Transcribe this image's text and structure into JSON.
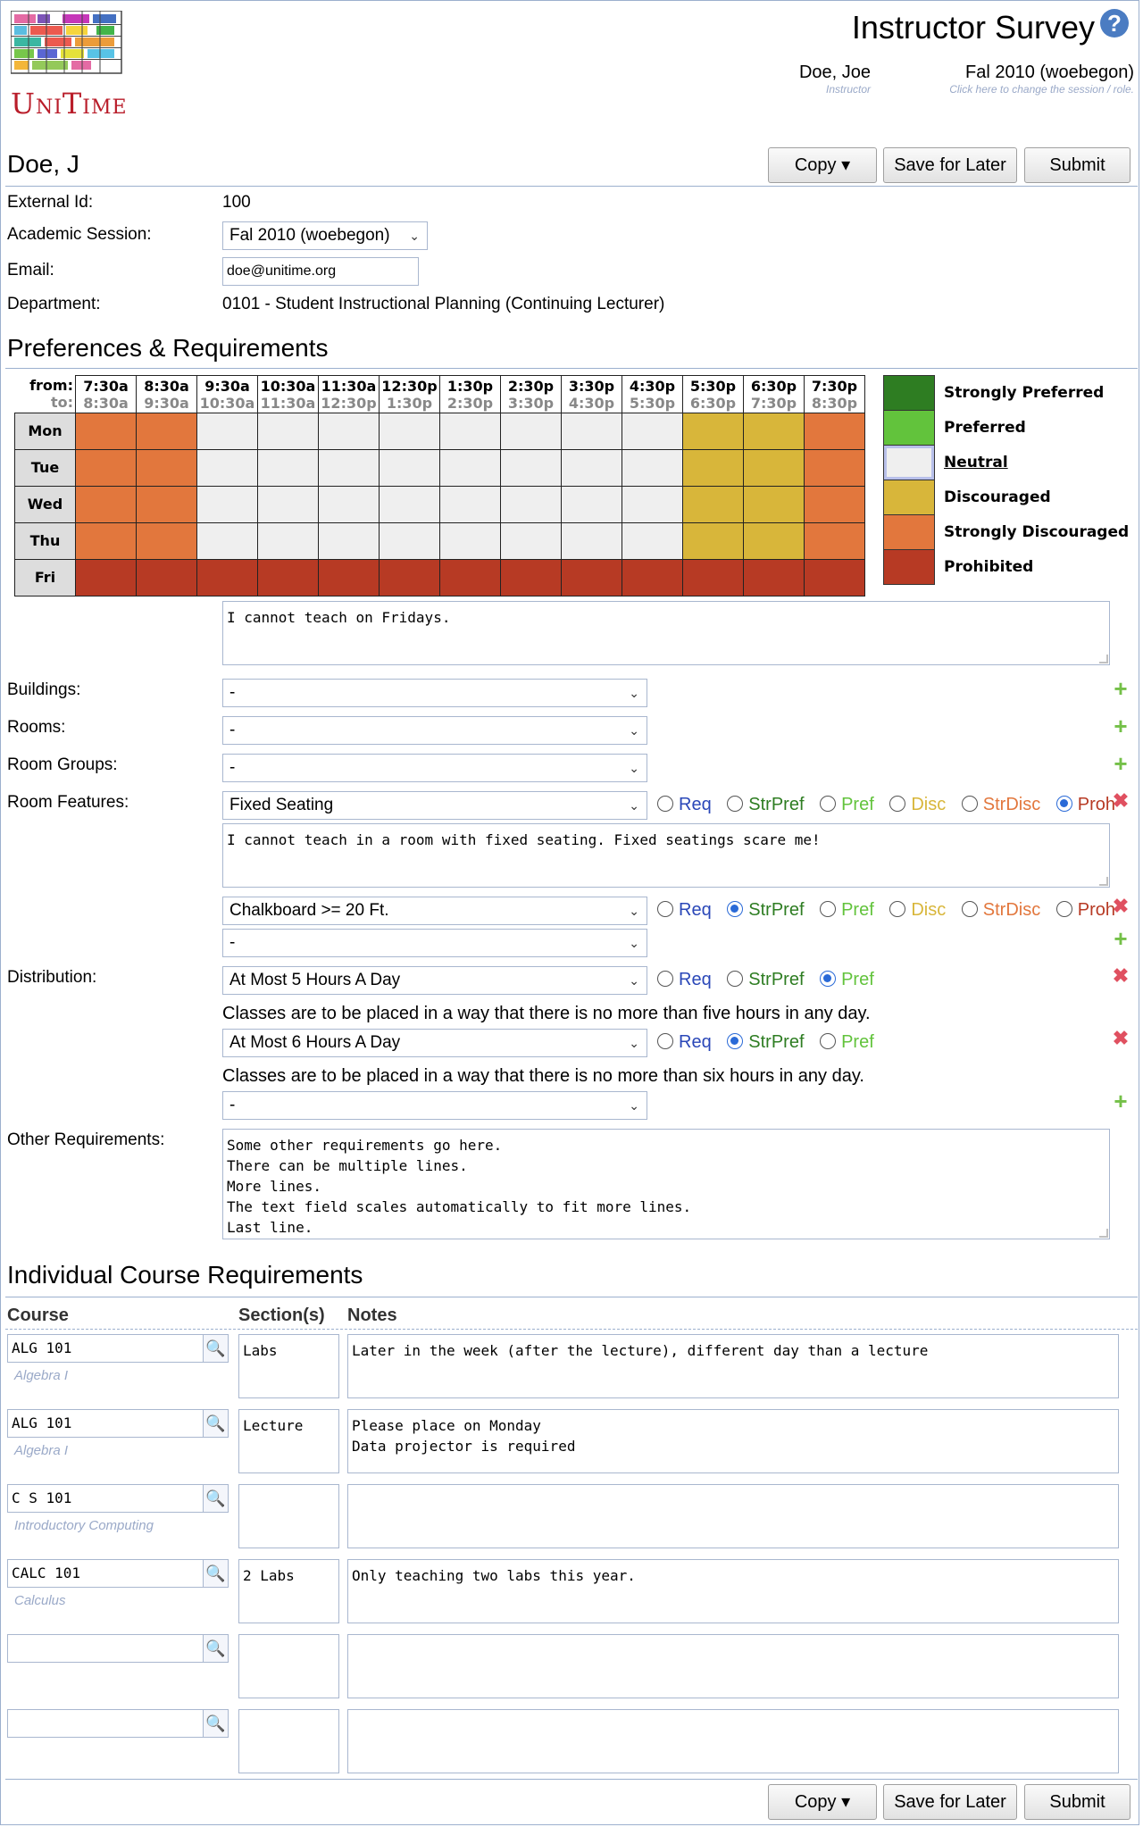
{
  "app": {
    "logo_text": "UniTime",
    "title": "Instructor Survey",
    "help": "?"
  },
  "header": {
    "user_name": "Doe, Joe",
    "user_role": "Instructor",
    "session": "Fal 2010 (woebegon)",
    "session_hint": "Click here to change the session / role."
  },
  "toolbar": {
    "title": "Doe, J",
    "copy": "Copy ▾",
    "save": "Save for Later",
    "submit": "Submit"
  },
  "info": {
    "external_id_label": "External Id:",
    "external_id": "100",
    "session_label": "Academic Session:",
    "session": "Fal 2010 (woebegon)",
    "email_label": "Email:",
    "email": "doe@unitime.org",
    "department_label": "Department:",
    "department": "0101 - Student Instructional Planning (Continuing Lecturer)"
  },
  "prefs": {
    "section_title": "Preferences & Requirements",
    "grid": {
      "from_label": "from:",
      "to_label": "to:",
      "columns": [
        {
          "from": "7:30a",
          "to": "8:30a"
        },
        {
          "from": "8:30a",
          "to": "9:30a"
        },
        {
          "from": "9:30a",
          "to": "10:30a"
        },
        {
          "from": "10:30a",
          "to": "11:30a"
        },
        {
          "from": "11:30a",
          "to": "12:30p"
        },
        {
          "from": "12:30p",
          "to": "1:30p"
        },
        {
          "from": "1:30p",
          "to": "2:30p"
        },
        {
          "from": "2:30p",
          "to": "3:30p"
        },
        {
          "from": "3:30p",
          "to": "4:30p"
        },
        {
          "from": "4:30p",
          "to": "5:30p"
        },
        {
          "from": "5:30p",
          "to": "6:30p"
        },
        {
          "from": "6:30p",
          "to": "7:30p"
        },
        {
          "from": "7:30p",
          "to": "8:30p"
        }
      ],
      "days": [
        "Mon",
        "Tue",
        "Wed",
        "Thu",
        "Fri"
      ],
      "cells": [
        [
          "SD",
          "SD",
          "N",
          "N",
          "N",
          "N",
          "N",
          "N",
          "N",
          "N",
          "D",
          "D",
          "SD"
        ],
        [
          "SD",
          "SD",
          "N",
          "N",
          "N",
          "N",
          "N",
          "N",
          "N",
          "N",
          "D",
          "D",
          "SD"
        ],
        [
          "SD",
          "SD",
          "N",
          "N",
          "N",
          "N",
          "N",
          "N",
          "N",
          "N",
          "D",
          "D",
          "SD"
        ],
        [
          "SD",
          "SD",
          "N",
          "N",
          "N",
          "N",
          "N",
          "N",
          "N",
          "N",
          "D",
          "D",
          "SD"
        ],
        [
          "P",
          "P",
          "P",
          "P",
          "P",
          "P",
          "P",
          "P",
          "P",
          "P",
          "P",
          "P",
          "P"
        ]
      ]
    },
    "legend": [
      {
        "code": "SP",
        "label": "Strongly Preferred",
        "color": "#2e7d22"
      },
      {
        "code": "PR",
        "label": "Preferred",
        "color": "#62c33c"
      },
      {
        "code": "N",
        "label": "Neutral",
        "color": "#efefef"
      },
      {
        "code": "D",
        "label": "Discouraged",
        "color": "#d8b63a"
      },
      {
        "code": "SD",
        "label": "Strongly Discouraged",
        "color": "#e2773d"
      },
      {
        "code": "P",
        "label": "Prohibited",
        "color": "#b73a24"
      }
    ],
    "time_note": "I cannot teach on Fridays.",
    "buildings_label": "Buildings:",
    "buildings": "-",
    "rooms_label": "Rooms:",
    "rooms": "-",
    "room_groups_label": "Room Groups:",
    "room_groups": "-",
    "room_features_label": "Room Features:",
    "feature1": "Fixed Seating",
    "feature1_note": "I cannot teach in a room with fixed seating. Fixed seatings scare me!",
    "feature2": "Chalkboard >= 20 Ft.",
    "feature3": "-",
    "levels": {
      "req": "Req",
      "strpref": "StrPref",
      "pref": "Pref",
      "disc": "Disc",
      "strdisc": "StrDisc",
      "proh": "Proh"
    },
    "distribution_label": "Distribution:",
    "dist1": "At Most 5 Hours A Day",
    "dist1_desc": "Classes are to be placed in a way that there is no more than five hours in any day.",
    "dist2": "At Most 6 Hours A Day",
    "dist2_desc": "Classes are to be placed in a way that there is no more than six hours in any day.",
    "dist3": "-",
    "other_label": "Other Requirements:",
    "other": "Some other requirements go here.\nThere can be multiple lines.\nMore lines.\nThe text field scales automatically to fit more lines.\nLast line."
  },
  "courses": {
    "section_title": "Individual Course Requirements",
    "headers": {
      "course": "Course",
      "sections": "Section(s)",
      "notes": "Notes"
    },
    "rows": [
      {
        "course": "ALG 101",
        "title": "Algebra I",
        "sections": "Labs",
        "notes": "Later in the week (after the lecture), different day than a lecture"
      },
      {
        "course": "ALG 101",
        "title": "Algebra I",
        "sections": "Lecture",
        "notes": "Please place on Monday\nData projector is required"
      },
      {
        "course": "C S 101",
        "title": "Introductory Computing",
        "sections": "",
        "notes": ""
      },
      {
        "course": "CALC 101",
        "title": "Calculus",
        "sections": "2 Labs",
        "notes": "Only teaching two labs this year."
      },
      {
        "course": "",
        "title": "",
        "sections": "",
        "notes": ""
      },
      {
        "course": "",
        "title": "",
        "sections": "",
        "notes": ""
      }
    ]
  }
}
